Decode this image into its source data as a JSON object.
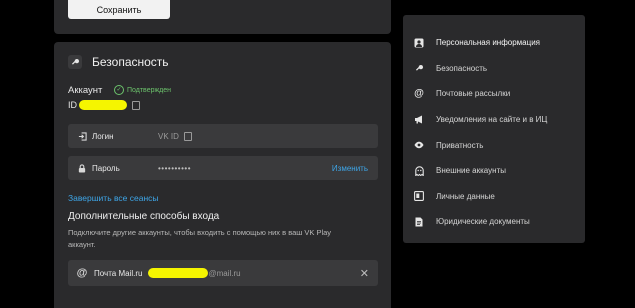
{
  "top": {
    "save_label": "Сохранить"
  },
  "security": {
    "title": "Безопасность",
    "title_icon": "key-icon",
    "account_label": "Аккаунт",
    "verified_label": "Подтвержден",
    "id_label": "ID",
    "login": {
      "label": "Логин",
      "value": "VK ID"
    },
    "password": {
      "label": "Пароль",
      "value": "••••••••••",
      "change_label": "Изменить"
    },
    "end_sessions_label": "Завершить все сеансы",
    "extra": {
      "title": "Дополнительные способы входа",
      "description": "Подключите другие аккаунты, чтобы входить с помощью них в ваш VK Play аккаунт.",
      "mail_label": "Почта Mail.ru",
      "mail_suffix": "@mail.ru"
    }
  },
  "sidebar": {
    "items": [
      {
        "label": "Персональная информация",
        "icon": "person-icon"
      },
      {
        "label": "Безопасность",
        "icon": "key-icon"
      },
      {
        "label": "Почтовые рассылки",
        "icon": "at-icon"
      },
      {
        "label": "Уведомления на сайте и в ИЦ",
        "icon": "megaphone-icon"
      },
      {
        "label": "Приватность",
        "icon": "eye-icon"
      },
      {
        "label": "Внешние аккаунты",
        "icon": "ghost-icon"
      },
      {
        "label": "Личные данные",
        "icon": "id-card-icon"
      },
      {
        "label": "Юридические документы",
        "icon": "document-icon"
      }
    ]
  },
  "colors": {
    "accent": "#3ea6e8",
    "verified": "#6cc36c",
    "panel": "#2a2a2c",
    "row": "#3a3a3c",
    "redaction": "#f5f500"
  }
}
